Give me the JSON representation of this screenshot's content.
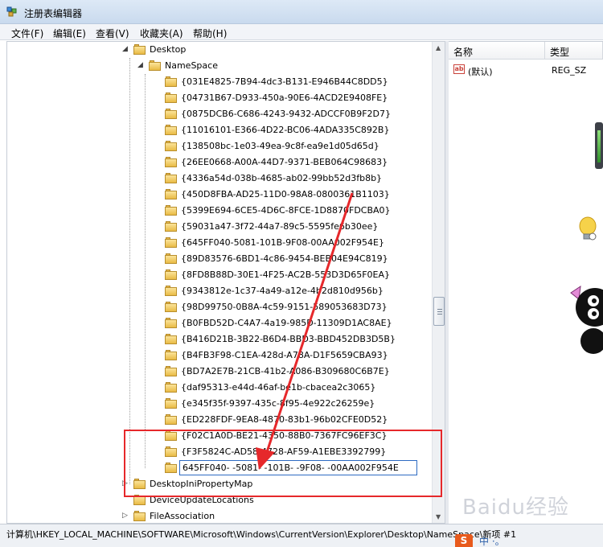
{
  "window": {
    "title": "注册表编辑器"
  },
  "menu": [
    "文件(F)",
    "编辑(E)",
    "查看(V)",
    "收藏夹(A)",
    "帮助(H)"
  ],
  "tree": {
    "rows": [
      {
        "label": "Desktop",
        "expander": "◢"
      },
      {
        "label": "NameSpace",
        "expander": "◢"
      },
      {
        "label": "{031E4825-7B94-4dc3-B131-E946B44C8DD5}"
      },
      {
        "label": "{04731B67-D933-450a-90E6-4ACD2E9408FE}"
      },
      {
        "label": "{0875DCB6-C686-4243-9432-ADCCF0B9F2D7}"
      },
      {
        "label": "{11016101-E366-4D22-BC06-4ADA335C892B}"
      },
      {
        "label": "{138508bc-1e03-49ea-9c8f-ea9e1d05d65d}"
      },
      {
        "label": "{26EE0668-A00A-44D7-9371-BEB064C98683}"
      },
      {
        "label": "{4336a54d-038b-4685-ab02-99bb52d3fb8b}"
      },
      {
        "label": "{450D8FBA-AD25-11D0-98A8-0800361B1103}"
      },
      {
        "label": "{5399E694-6CE5-4D6C-8FCE-1D8870FDCBA0}"
      },
      {
        "label": "{59031a47-3f72-44a7-89c5-5595fe6b30ee}"
      },
      {
        "label": "{645FF040-5081-101B-9F08-00AA002F954E}"
      },
      {
        "label": "{89D83576-6BD1-4c86-9454-BEB04E94C819}"
      },
      {
        "label": "{8FD8B88D-30E1-4F25-AC2B-553D3D65F0EA}"
      },
      {
        "label": "{9343812e-1c37-4a49-a12e-4b2d810d956b}"
      },
      {
        "label": "{98D99750-0B8A-4c59-9151-589053683D73}"
      },
      {
        "label": "{B0FBD52D-C4A7-4a19-985D-11309D1AC8AE}"
      },
      {
        "label": "{B416D21B-3B22-B6D4-BBD3-BBD452DB3D5B}"
      },
      {
        "label": "{B4FB3F98-C1EA-428d-A78A-D1F5659CBA93}"
      },
      {
        "label": "{BD7A2E7B-21CB-41b2-A086-B309680C6B7E}"
      },
      {
        "label": "{daf95313-e44d-46af-be1b-cbacea2c3065}"
      },
      {
        "label": "{e345f35f-9397-435c-8f95-4e922c26259e}"
      },
      {
        "label": "{ED228FDF-9EA8-4870-83b1-96b02CFE0D52}"
      },
      {
        "label": "{F02C1A0D-BE21-4350-88B0-7367FC96EF3C}"
      },
      {
        "label": "{F3F5824C-AD58-4728-AF59-A1EBE3392799}"
      },
      {
        "label": "645FF040- -5081- -101B- -9F08- -00AA002F954E",
        "editing": true
      },
      {
        "label": "DesktopIniPropertyMap",
        "expander": "▷"
      },
      {
        "label": "DeviceUpdateLocations"
      },
      {
        "label": "FileAssociation",
        "expander": "▷"
      }
    ]
  },
  "values_pane": {
    "columns": [
      "名称",
      "类型"
    ],
    "rows": [
      {
        "icon": "ab",
        "name": "(默认)",
        "type": "REG_SZ"
      }
    ]
  },
  "statusbar": {
    "path": "计算机\\HKEY_LOCAL_MACHINE\\SOFTWARE\\Microsoft\\Windows\\CurrentVersion\\Explorer\\Desktop\\NameSpace\\新项 #1"
  },
  "overlay": {
    "watermark": "Baidu经验",
    "badge_letter": "S",
    "badge_text": "中 ·。"
  },
  "colors": {
    "annotation_red": "#e6282b",
    "selection_border": "#2d6bc3"
  }
}
